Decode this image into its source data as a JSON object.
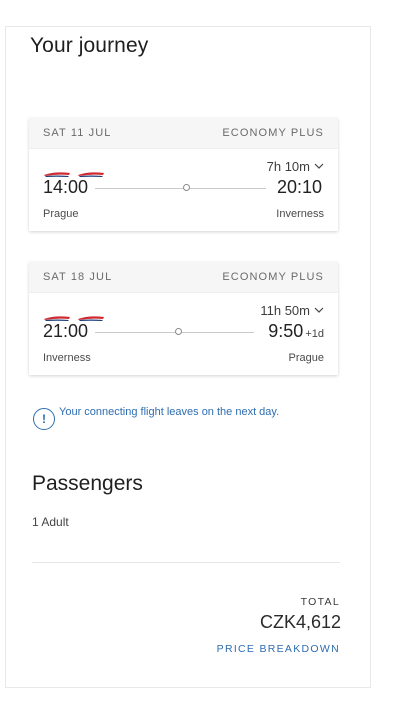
{
  "journey": {
    "title": "Your journey",
    "flights": [
      {
        "date": "SAT 11 JUL",
        "cabin": "ECONOMY PLUS",
        "duration": "7h 10m",
        "departure_time": "14:00",
        "arrival_time": "20:10",
        "arrival_day_offset": "",
        "departure_city": "Prague",
        "arrival_city": "Inverness"
      },
      {
        "date": "SAT 18 JUL",
        "cabin": "ECONOMY PLUS",
        "duration": "11h 50m",
        "departure_time": "21:00",
        "arrival_time": "9:50",
        "arrival_day_offset": "+1d",
        "departure_city": "Inverness",
        "arrival_city": "Prague"
      }
    ],
    "notice": "Your connecting flight leaves on the next day.",
    "notice_icon": "exclamation-circle-icon"
  },
  "passengers": {
    "title": "Passengers",
    "count": "1 Adult"
  },
  "price": {
    "total_label": "TOTAL",
    "total_amount": "CZK4,612",
    "breakdown_label": "PRICE BREAKDOWN"
  },
  "colors": {
    "link_blue": "#2e6db0",
    "airline_red": "#d42a2f",
    "airline_navy": "#1b3d7a"
  }
}
